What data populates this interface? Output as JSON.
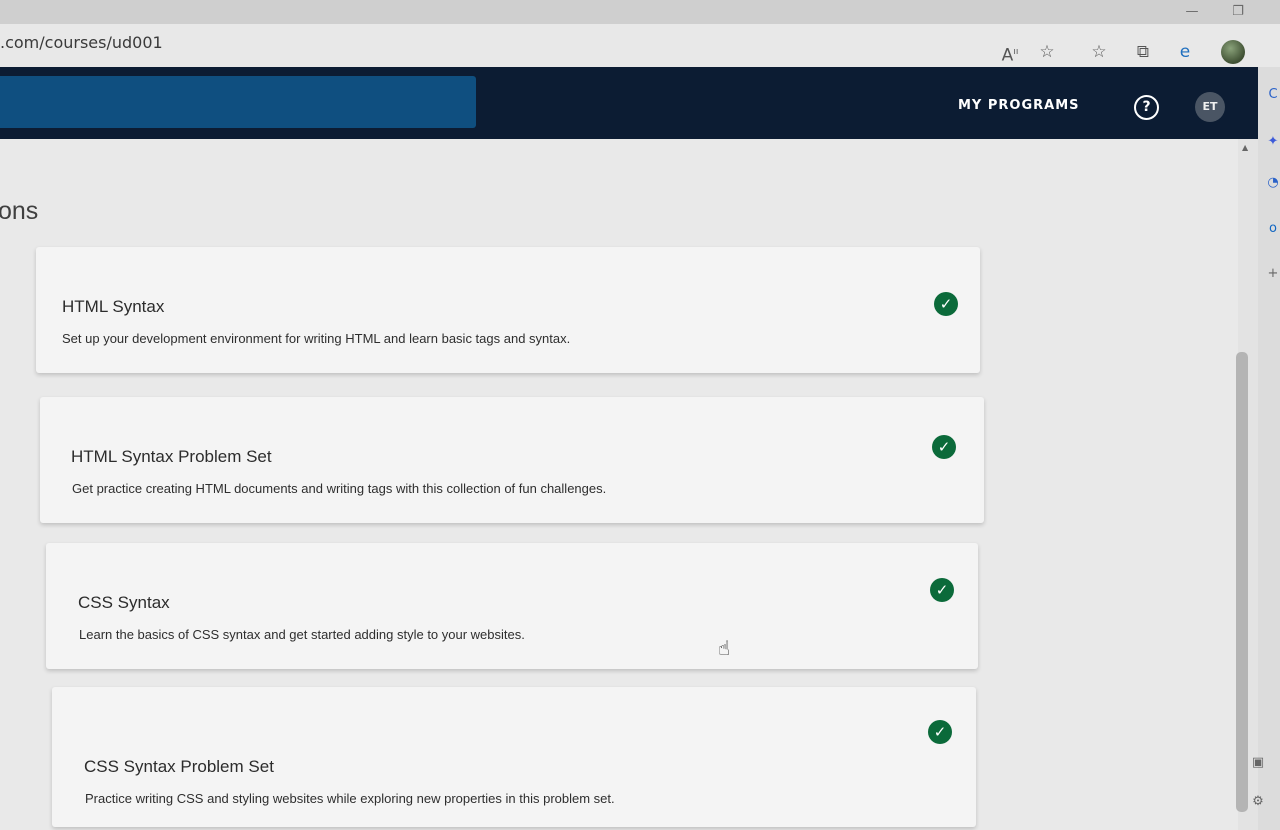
{
  "browser": {
    "url": ".com/courses/ud001",
    "controls": {
      "minimize": "—",
      "restore": "❐"
    }
  },
  "header": {
    "nav_programs": "MY PROGRAMS",
    "help": "?",
    "user_initials": "ET"
  },
  "page": {
    "section_title": "ons"
  },
  "lessons": [
    {
      "title": "HTML Syntax",
      "description": "Set up your development environment for writing HTML and learn basic tags and syntax.",
      "completed": true
    },
    {
      "title": "HTML Syntax Problem Set",
      "description": "Get practice creating HTML documents and writing tags with this collection of fun challenges.",
      "completed": true
    },
    {
      "title": "CSS Syntax",
      "description": "Learn the basics of CSS syntax and get started adding style to your websites.",
      "completed": true
    },
    {
      "title": "CSS Syntax Problem Set",
      "description": "Practice writing CSS and styling websites while exploring new properties in this problem set.",
      "completed": true
    }
  ],
  "colors": {
    "header_bg": "#0c1c33",
    "logo_bar": "#0f4f80",
    "check_green": "#0b6a3a"
  }
}
